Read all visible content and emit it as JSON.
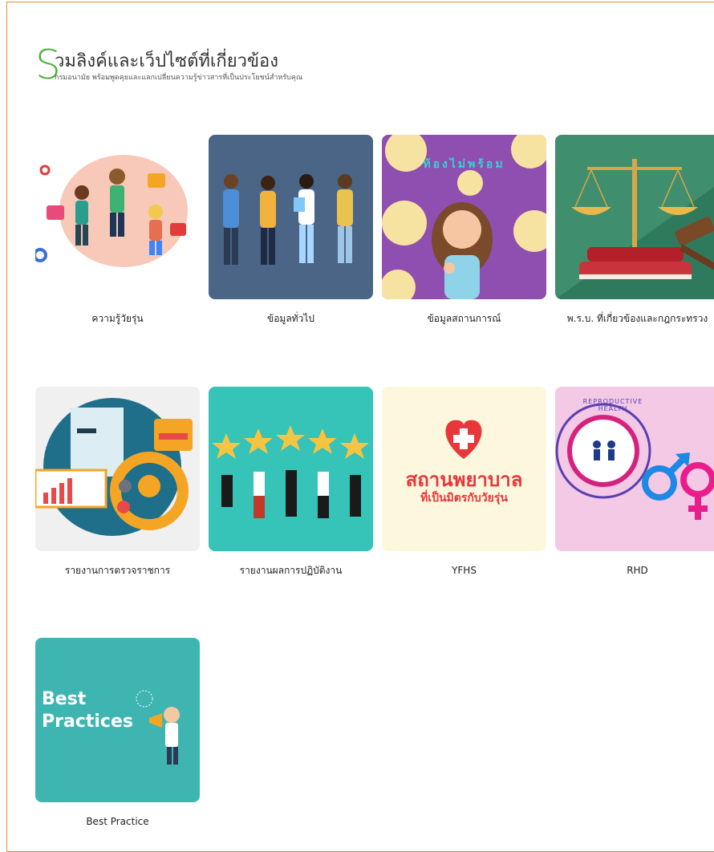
{
  "header": {
    "big_letter": "S",
    "title": "วมลิงค์และเว็ปไซต์ที่เกี่ยวข้อง",
    "subtitle": "กรมอนามัย พร้อมพูดคุยและแลกเปลี่ยนความรู้ข่าวสารที่เป็นประโยชน์สำหรับคุณ"
  },
  "cards": [
    {
      "label": "ความรู้วัยรุ่น"
    },
    {
      "label": "ข้อมูลทั่วไป"
    },
    {
      "label": "ข้อมูลสถานการณ์",
      "overlay": "ท้องไม่พร้อม"
    },
    {
      "label": "พ.ร.บ. ที่เกี่ยวข้องและกฎกระทรวง"
    },
    {
      "label": "รายงานการตรวจราชการ"
    },
    {
      "label": "รายงานผลการปฏิบัติงาน"
    },
    {
      "label": "YFHS",
      "overlay_line1": "สถานพยาบาล",
      "overlay_line2": "ที่เป็นมิตรกับวัยรุ่น"
    },
    {
      "label": "RHD",
      "overlay": "REPRODUCTIVE HEALTH"
    },
    {
      "label": "Best Practice",
      "overlay_line1": "Best",
      "overlay_line2": "Practices"
    }
  ],
  "colors": {
    "border": "#e08a3a",
    "accent_green": "#4fae3a"
  }
}
